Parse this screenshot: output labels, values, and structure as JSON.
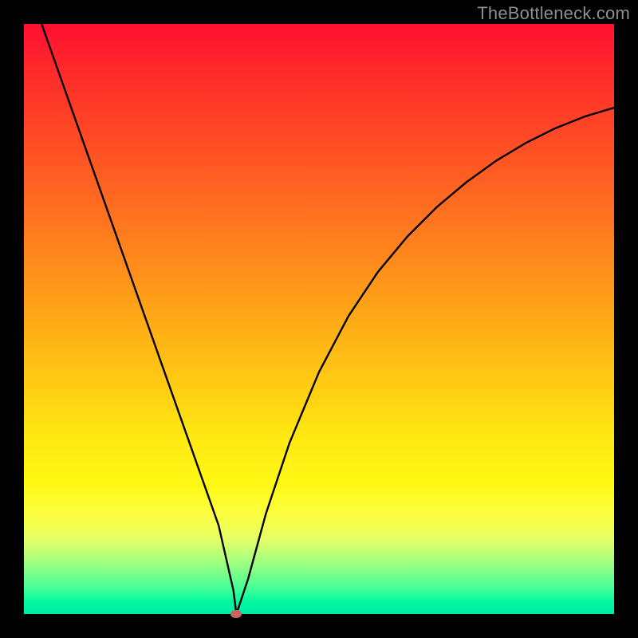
{
  "watermark": "TheBottleneck.com",
  "colors": {
    "frame": "#000000",
    "curve": "#000000",
    "marker": "#c9635b"
  },
  "chart_data": {
    "type": "line",
    "title": "",
    "xlabel": "",
    "ylabel": "",
    "xlim": [
      0,
      100
    ],
    "ylim": [
      0,
      100
    ],
    "grid": false,
    "series": [
      {
        "name": "bottleneck-curve",
        "x": [
          3,
          6,
          9,
          12,
          15,
          18,
          21,
          24,
          27,
          30,
          33,
          35.5,
          36,
          38,
          41,
          45,
          50,
          55,
          60,
          65,
          70,
          75,
          80,
          85,
          90,
          95,
          100
        ],
        "values": [
          100,
          91.5,
          83,
          74.5,
          66,
          57.5,
          49,
          40.5,
          32,
          23.5,
          15,
          4,
          0,
          6,
          17,
          29,
          41,
          50.5,
          58,
          64,
          69,
          73.2,
          76.8,
          79.8,
          82.3,
          84.3,
          85.8
        ]
      }
    ],
    "marker": {
      "x": 36,
      "y": 0
    }
  }
}
